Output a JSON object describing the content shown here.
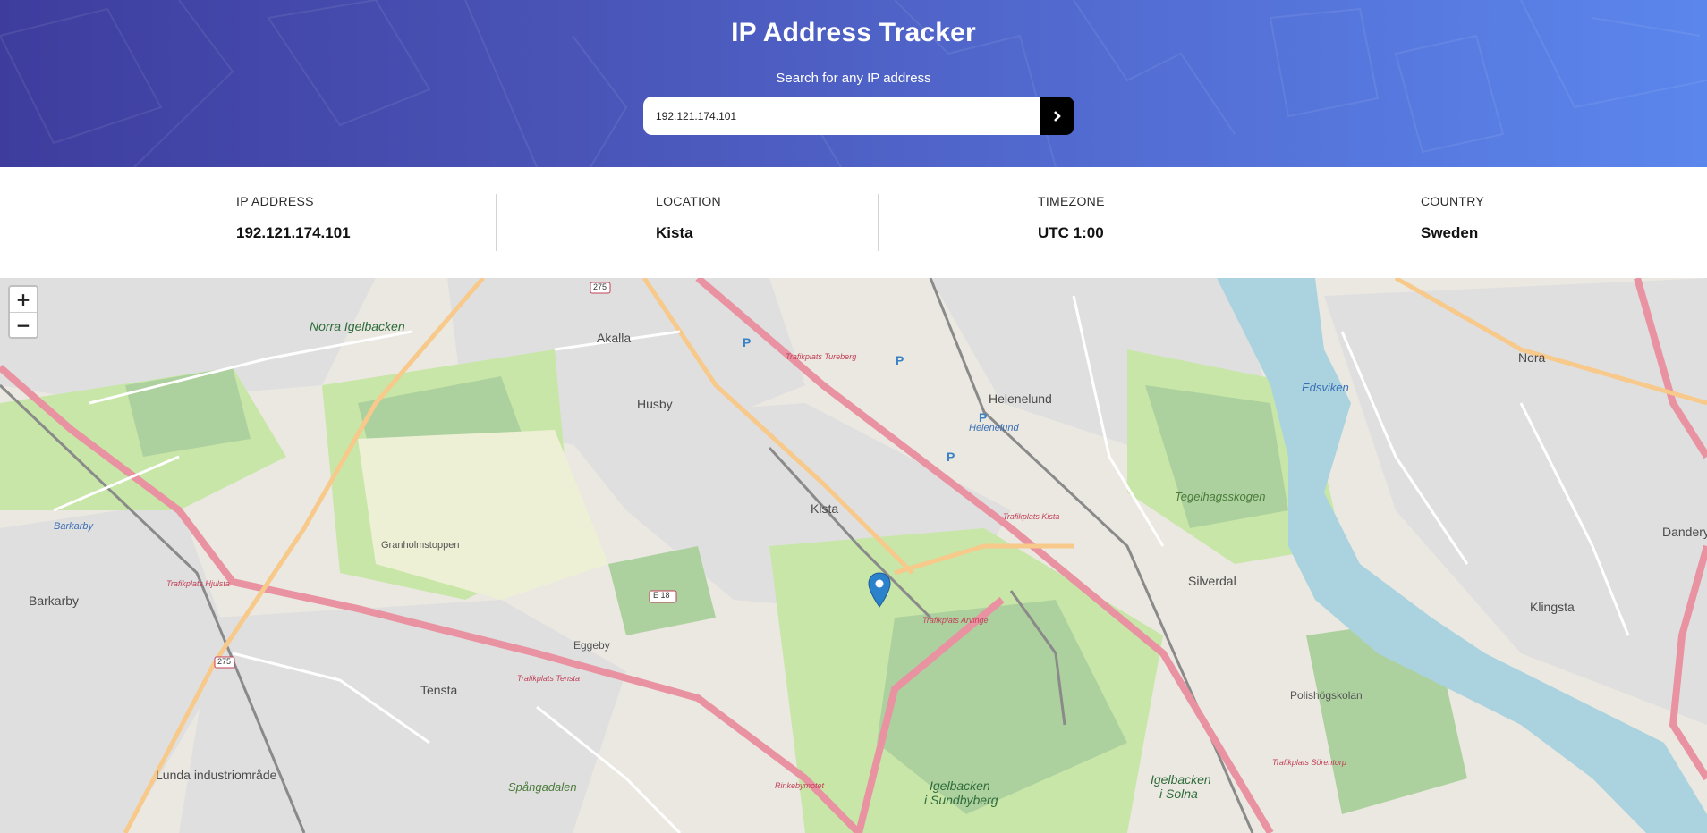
{
  "header": {
    "title": "IP Address Tracker",
    "subtitle": "Search for any IP address",
    "search_value": "192.121.174.101",
    "submit_icon": "chevron-right-icon"
  },
  "info": {
    "ip": {
      "label": "IP ADDRESS",
      "value": "192.121.174.101"
    },
    "location": {
      "label": "LOCATION",
      "value": "Kista"
    },
    "timezone": {
      "label": "TIMEZONE",
      "value": "UTC 1:00"
    },
    "country": {
      "label": "COUNTRY",
      "value": "Sweden"
    }
  },
  "map": {
    "zoom_in": "+",
    "zoom_out": "−",
    "marker_icon": "location-pin-icon",
    "places": {
      "akalla": "Akalla",
      "husby": "Husby",
      "kista": "Kista",
      "helenelund": "Helenelund",
      "helenelund_station": "Helenelund",
      "barkarby": "Barkarby",
      "barkarby_station": "Barkarby",
      "tensta": "Tensta",
      "eggeby": "Eggeby",
      "silverdal": "Silverdal",
      "nora": "Nora",
      "edsviken": "Edsviken",
      "danderyd": "Danderyd",
      "klingsta": "Klingsta",
      "polishogskolan": "Polishögskolan",
      "tegelhagsskogen": "Tegelhagsskogen",
      "norra_igelbacken": "Norra Igelbacken",
      "igelbacken_sundbyberg_1": "Igelbacken",
      "igelbacken_sundbyberg_2": "i Sundbyberg",
      "igelbacken_solna_1": "Igelbacken",
      "igelbacken_solna_2": "i Solna",
      "lunda": "Lunda industriområde",
      "spangadalen": "Spångadalen",
      "granholmstoppen": "Granholmstoppen",
      "trafikplats_tureberg": "Trafikplats Tureberg",
      "trafikplats_kista": "Trafikplats Kista",
      "trafikplats_arvinge": "Trafikplats Arvinge",
      "trafikplats_hjulsta": "Trafikplats Hjulsta",
      "trafikplats_tensta": "Trafikplats Tensta",
      "trafikplats_sorentorp": "Trafikplats Sörentorp",
      "rinkebymotet": "Rinkebymotet",
      "e18": "E 18",
      "r275": "275",
      "r275b": "275"
    },
    "colors": {
      "motorway": "#e892a2",
      "primary": "#fcd6a4",
      "park": "#c8e6a8",
      "forest": "#add19e",
      "water": "#aad3df",
      "residential": "#e0dfdf"
    }
  }
}
